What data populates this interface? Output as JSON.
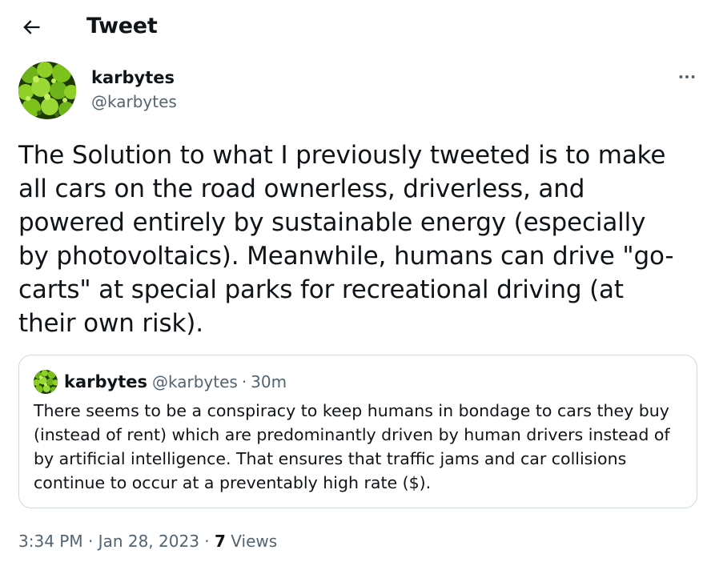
{
  "header": {
    "title": "Tweet",
    "back_icon": "arrow-left-icon"
  },
  "tweet": {
    "author_name": "karbytes",
    "author_handle": "@karbytes",
    "more_icon": "more-horizontal-icon",
    "text": "The Solution to what I previously tweeted is to make\nall cars on the road ownerless, driverless, and\npowered entirely by sustainable energy (especially\nby photovoltaics). Meanwhile, humans can drive \"go-\ncarts\" at special parks for recreational driving (at\ntheir own risk).",
    "time": "3:34 PM",
    "date": "Jan 28, 2023",
    "separator": "·",
    "views_count": "7",
    "views_label": "Views"
  },
  "quoted_tweet": {
    "author_name": "karbytes",
    "author_handle": "@karbytes",
    "separator": "·",
    "relative_time": "30m",
    "text": "There seems to be a conspiracy to keep humans in bondage to cars they buy\n(instead of rent) which are predominantly driven by human drivers instead of\nby artificial intelligence. That ensures that traffic jams and car collisions\ncontinue to occur at a preventably high rate ($)."
  },
  "colors": {
    "text_primary": "#0f1419",
    "text_secondary": "#536471",
    "border": "#cfd9de",
    "avatar_green": "#7cc21a"
  }
}
